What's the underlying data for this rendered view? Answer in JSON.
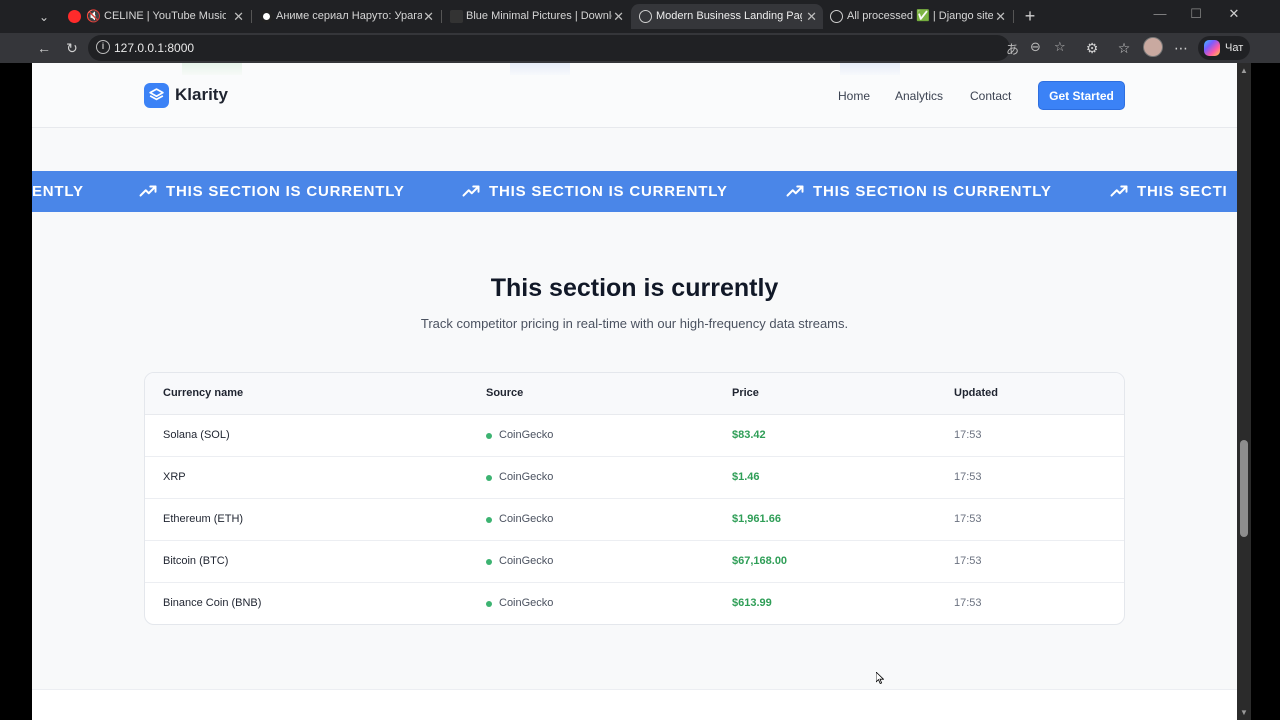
{
  "browser": {
    "tabs": [
      {
        "title": "CELINE | YouTube Music"
      },
      {
        "title": "Аниме сериал Наруто: Ураганные"
      },
      {
        "title": "Blue Minimal Pictures | Download"
      },
      {
        "title": "Modern Business Landing Page Ex"
      },
      {
        "title": "All processed ✅ | Django site adm"
      }
    ],
    "url": "127.0.0.1:8000",
    "chat_label": "Чат"
  },
  "site": {
    "brand": "Klarity",
    "nav": [
      "Home",
      "Analytics",
      "Contact"
    ],
    "cta": "Get Started",
    "marquee_text": "THIS SECTION IS CURRENTLY",
    "marquee_fragments": [
      "ENTLY",
      "THIS SECTI"
    ],
    "section_title": "This section is currently",
    "section_subtitle": "Track competitor pricing in real-time with our high-frequency data streams.",
    "table": {
      "headers": [
        "Currency name",
        "Source",
        "Price",
        "Updated"
      ],
      "rows": [
        {
          "name": "Solana (SOL)",
          "source": "CoinGecko",
          "price": "$83.42",
          "updated": "17:53"
        },
        {
          "name": "XRP",
          "source": "CoinGecko",
          "price": "$1.46",
          "updated": "17:53"
        },
        {
          "name": "Ethereum (ETH)",
          "source": "CoinGecko",
          "price": "$1,961.66",
          "updated": "17:53"
        },
        {
          "name": "Bitcoin (BTC)",
          "source": "CoinGecko",
          "price": "$67,168.00",
          "updated": "17:53"
        },
        {
          "name": "Binance Coin (BNB)",
          "source": "CoinGecko",
          "price": "$613.99",
          "updated": "17:53"
        }
      ]
    }
  },
  "colors": {
    "accent": "#3b82f6",
    "marquee_bg": "#4a86e8",
    "price": "#2f9e57",
    "status_dot": "#3cb371"
  },
  "icons": {
    "brand": "layers-icon",
    "marquee": "trending-up-icon",
    "status": "live-dot-icon"
  }
}
